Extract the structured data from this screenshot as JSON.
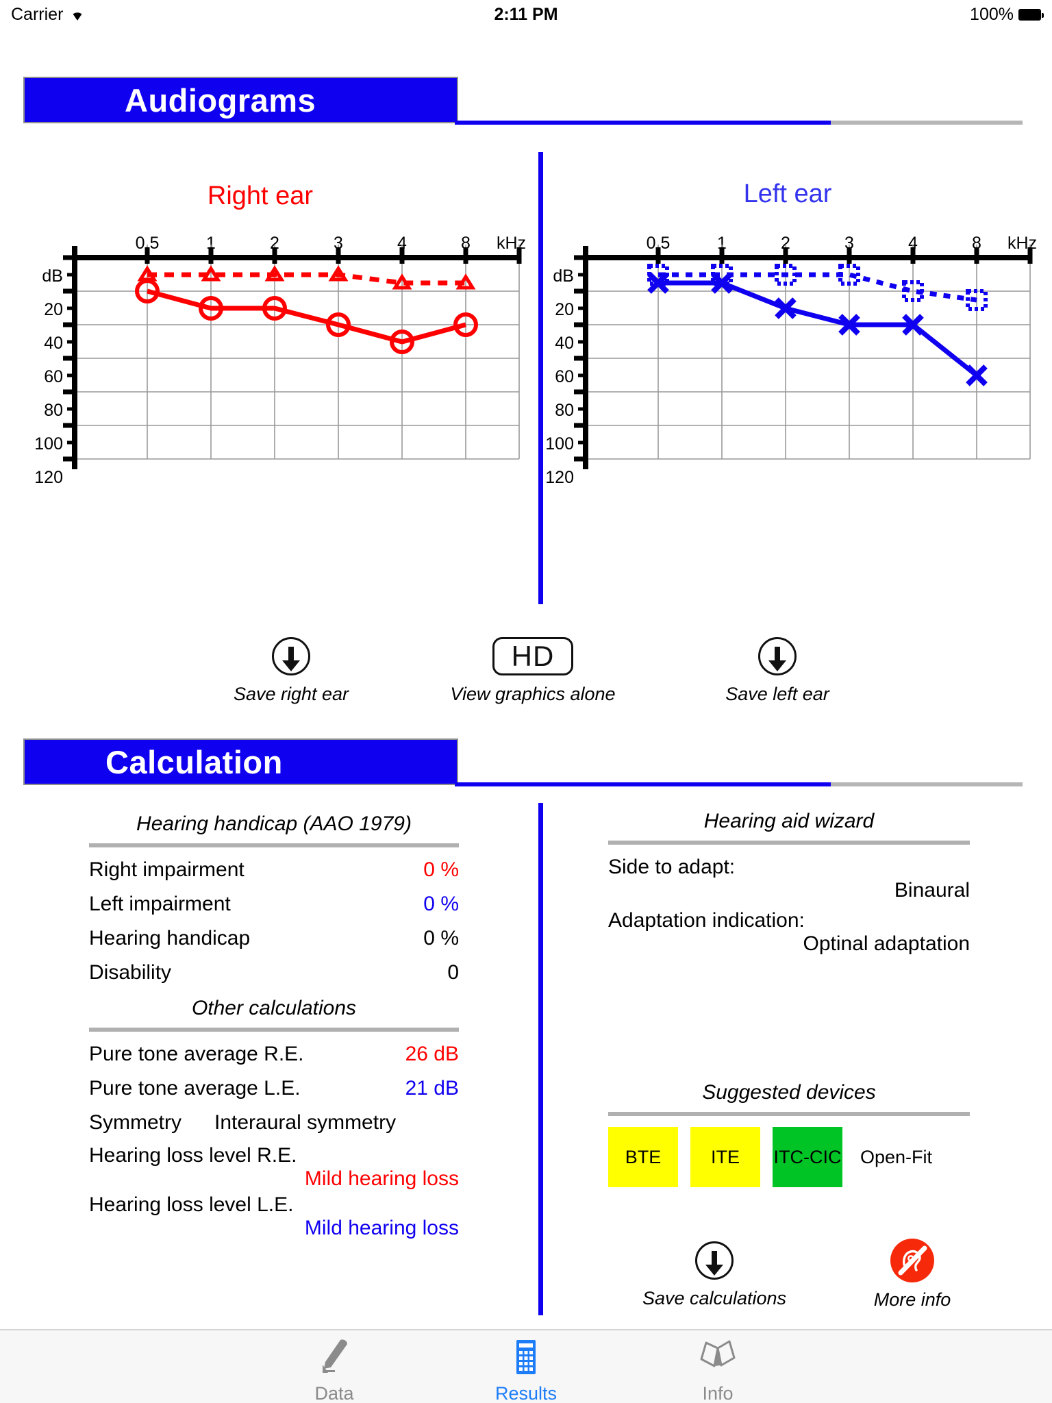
{
  "status_bar": {
    "carrier": "Carrier",
    "wifi_icon": "wifi-icon",
    "time": "2:11 PM",
    "battery_percent": "100%",
    "battery_icon": "battery-full-icon"
  },
  "sections": {
    "audiograms_title": "Audiograms",
    "calculation_title": "Calculation"
  },
  "audiogram_controls": {
    "save_right_label": "Save right ear",
    "hd_label": "HD",
    "view_graphics_label": "View graphics alone",
    "save_left_label": "Save left ear"
  },
  "hearing_handicap": {
    "title": "Hearing handicap (AAO 1979)",
    "rows": [
      {
        "label": "Right impairment",
        "value": "0 %",
        "color": "red"
      },
      {
        "label": "Left impairment",
        "value": "0 %",
        "color": "blue"
      },
      {
        "label": "Hearing handicap",
        "value": "0 %",
        "color": "black"
      },
      {
        "label": "Disability",
        "value": "0",
        "color": "black"
      }
    ]
  },
  "other_calculations": {
    "title": "Other calculations",
    "pta_right_label": "Pure tone average R.E.",
    "pta_right_value": "26 dB",
    "pta_left_label": "Pure tone average L.E.",
    "pta_left_value": "21 dB",
    "symmetry_label": "Symmetry",
    "symmetry_value": "Interaural symmetry",
    "loss_right_label": "Hearing loss level R.E.",
    "loss_right_value": "Mild hearing loss",
    "loss_left_label": "Hearing loss level L.E.",
    "loss_left_value": "Mild hearing loss"
  },
  "hearing_aid_wizard": {
    "title": "Hearing aid wizard",
    "side_label": "Side to adapt:",
    "side_value": "Binaural",
    "indication_label": "Adaptation indication:",
    "indication_value": "Optinal adaptation"
  },
  "suggested_devices": {
    "title": "Suggested devices",
    "chips": [
      {
        "label": "BTE",
        "style": "yellow"
      },
      {
        "label": "ITE",
        "style": "yellow"
      },
      {
        "label": "ITC-CIC",
        "style": "green"
      },
      {
        "label": "Open-Fit",
        "style": "none"
      }
    ],
    "save_label": "Save calculations",
    "more_info_label": "More info",
    "more_info_icon": "deaf-ear-icon"
  },
  "tab_bar": {
    "tabs": [
      {
        "label": "Data",
        "icon": "pencil-icon",
        "active": false
      },
      {
        "label": "Results",
        "icon": "calculator-icon",
        "active": true
      },
      {
        "label": "Info",
        "icon": "book-icon",
        "active": false
      }
    ]
  },
  "colors": {
    "right_ear": "#ff0000",
    "left_ear": "#1000f0",
    "banner": "#1000f0",
    "accent_tab": "#1d7df9",
    "chip_yellow": "#ffff00",
    "chip_green": "#00c425"
  },
  "chart_data": [
    {
      "type": "line",
      "title": "Right ear",
      "xlabel": "kHz",
      "ylabel": "dB",
      "x_ticks": [
        "0.5",
        "1",
        "2",
        "3",
        "4",
        "8"
      ],
      "y_ticks": [
        "dB",
        "20",
        "40",
        "60",
        "80",
        "100",
        "120"
      ],
      "ylim": [
        0,
        120
      ],
      "y_inverted": true,
      "grid": true,
      "series": [
        {
          "name": "Air conduction right",
          "marker": "circle",
          "line": "solid",
          "color": "#ff0000",
          "values": [
            20,
            25,
            25,
            30,
            35,
            30
          ]
        },
        {
          "name": "Bone conduction right",
          "marker": "triangle",
          "line": "dashed",
          "color": "#ff0000",
          "values": [
            10,
            10,
            10,
            10,
            15,
            15
          ]
        }
      ]
    },
    {
      "type": "line",
      "title": "Left ear",
      "xlabel": "kHz",
      "ylabel": "dB",
      "x_ticks": [
        "0.5",
        "1",
        "2",
        "3",
        "4",
        "8"
      ],
      "y_ticks": [
        "dB",
        "20",
        "40",
        "60",
        "80",
        "100",
        "120"
      ],
      "ylim": [
        0,
        120
      ],
      "y_inverted": true,
      "grid": true,
      "series": [
        {
          "name": "Air conduction left",
          "marker": "x",
          "line": "solid",
          "color": "#1000f0",
          "values": [
            15,
            15,
            25,
            30,
            30,
            45
          ]
        },
        {
          "name": "Bone conduction left",
          "marker": "square",
          "line": "dotted",
          "color": "#1000f0",
          "values": [
            10,
            10,
            10,
            10,
            20,
            25
          ]
        }
      ]
    }
  ]
}
